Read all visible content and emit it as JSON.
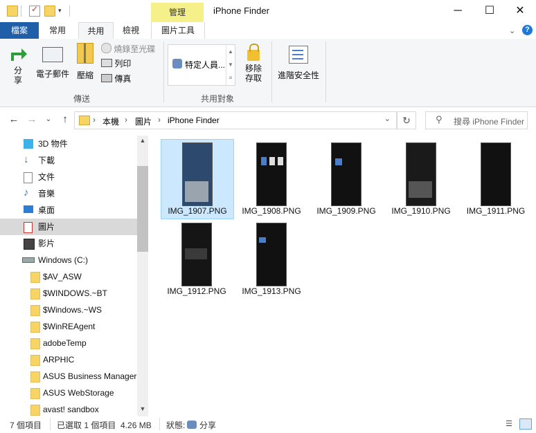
{
  "titlebar": {
    "title": "iPhone Finder",
    "manage_tab": "管理",
    "buttons": {
      "minimize": "─",
      "maximize": "☐",
      "close": "✕"
    }
  },
  "tabs": {
    "file": "檔案",
    "home": "常用",
    "share": "共用",
    "view": "檢視",
    "picture_tools": "圖片工具"
  },
  "ribbon": {
    "send_group": {
      "label": "傳送",
      "share": "分\n享",
      "email": "電子郵件",
      "zip": "壓縮",
      "burn": "燒錄至光碟",
      "print": "列印",
      "fax": "傳真"
    },
    "share_with_group": {
      "label": "共用對象",
      "specific_people": "特定人員..."
    },
    "remove_access": "移除\n存取",
    "advanced_security": "進階安全性"
  },
  "address": {
    "path": [
      "本機",
      "圖片",
      "iPhone Finder"
    ],
    "search_placeholder": "搜尋 iPhone Finder"
  },
  "nav": {
    "items": [
      {
        "label": "3D 物件",
        "icon": "3d-objects-icon"
      },
      {
        "label": "下載",
        "icon": "download-icon"
      },
      {
        "label": "文件",
        "icon": "documents-icon"
      },
      {
        "label": "音樂",
        "icon": "music-icon"
      },
      {
        "label": "桌面",
        "icon": "desktop-icon"
      },
      {
        "label": "圖片",
        "icon": "pictures-icon",
        "selected": true
      },
      {
        "label": "影片",
        "icon": "videos-icon"
      },
      {
        "label": "Windows (C:)",
        "icon": "drive-icon"
      }
    ],
    "folders": [
      "$AV_ASW",
      "$WINDOWS.~BT",
      "$Windows.~WS",
      "$WinREAgent",
      "adobeTemp",
      "ARPHIC",
      "ASUS Business Manager",
      "ASUS WebStorage",
      "avast! sandbox"
    ]
  },
  "files": [
    {
      "name": "IMG_1907.PNG",
      "selected": true
    },
    {
      "name": "IMG_1908.PNG"
    },
    {
      "name": "IMG_1909.PNG"
    },
    {
      "name": "IMG_1910.PNG"
    },
    {
      "name": "IMG_1911.PNG"
    },
    {
      "name": "IMG_1912.PNG"
    },
    {
      "name": "IMG_1913.PNG"
    }
  ],
  "status": {
    "count": "7 個項目",
    "selection": "已選取 1 個項目  4.26 MB",
    "state_label": "狀態:",
    "state_value": "分享"
  },
  "colors": {
    "accent": "#1f5ea8",
    "manage_tab": "#f6f08a",
    "selection": "#cce8ff"
  }
}
